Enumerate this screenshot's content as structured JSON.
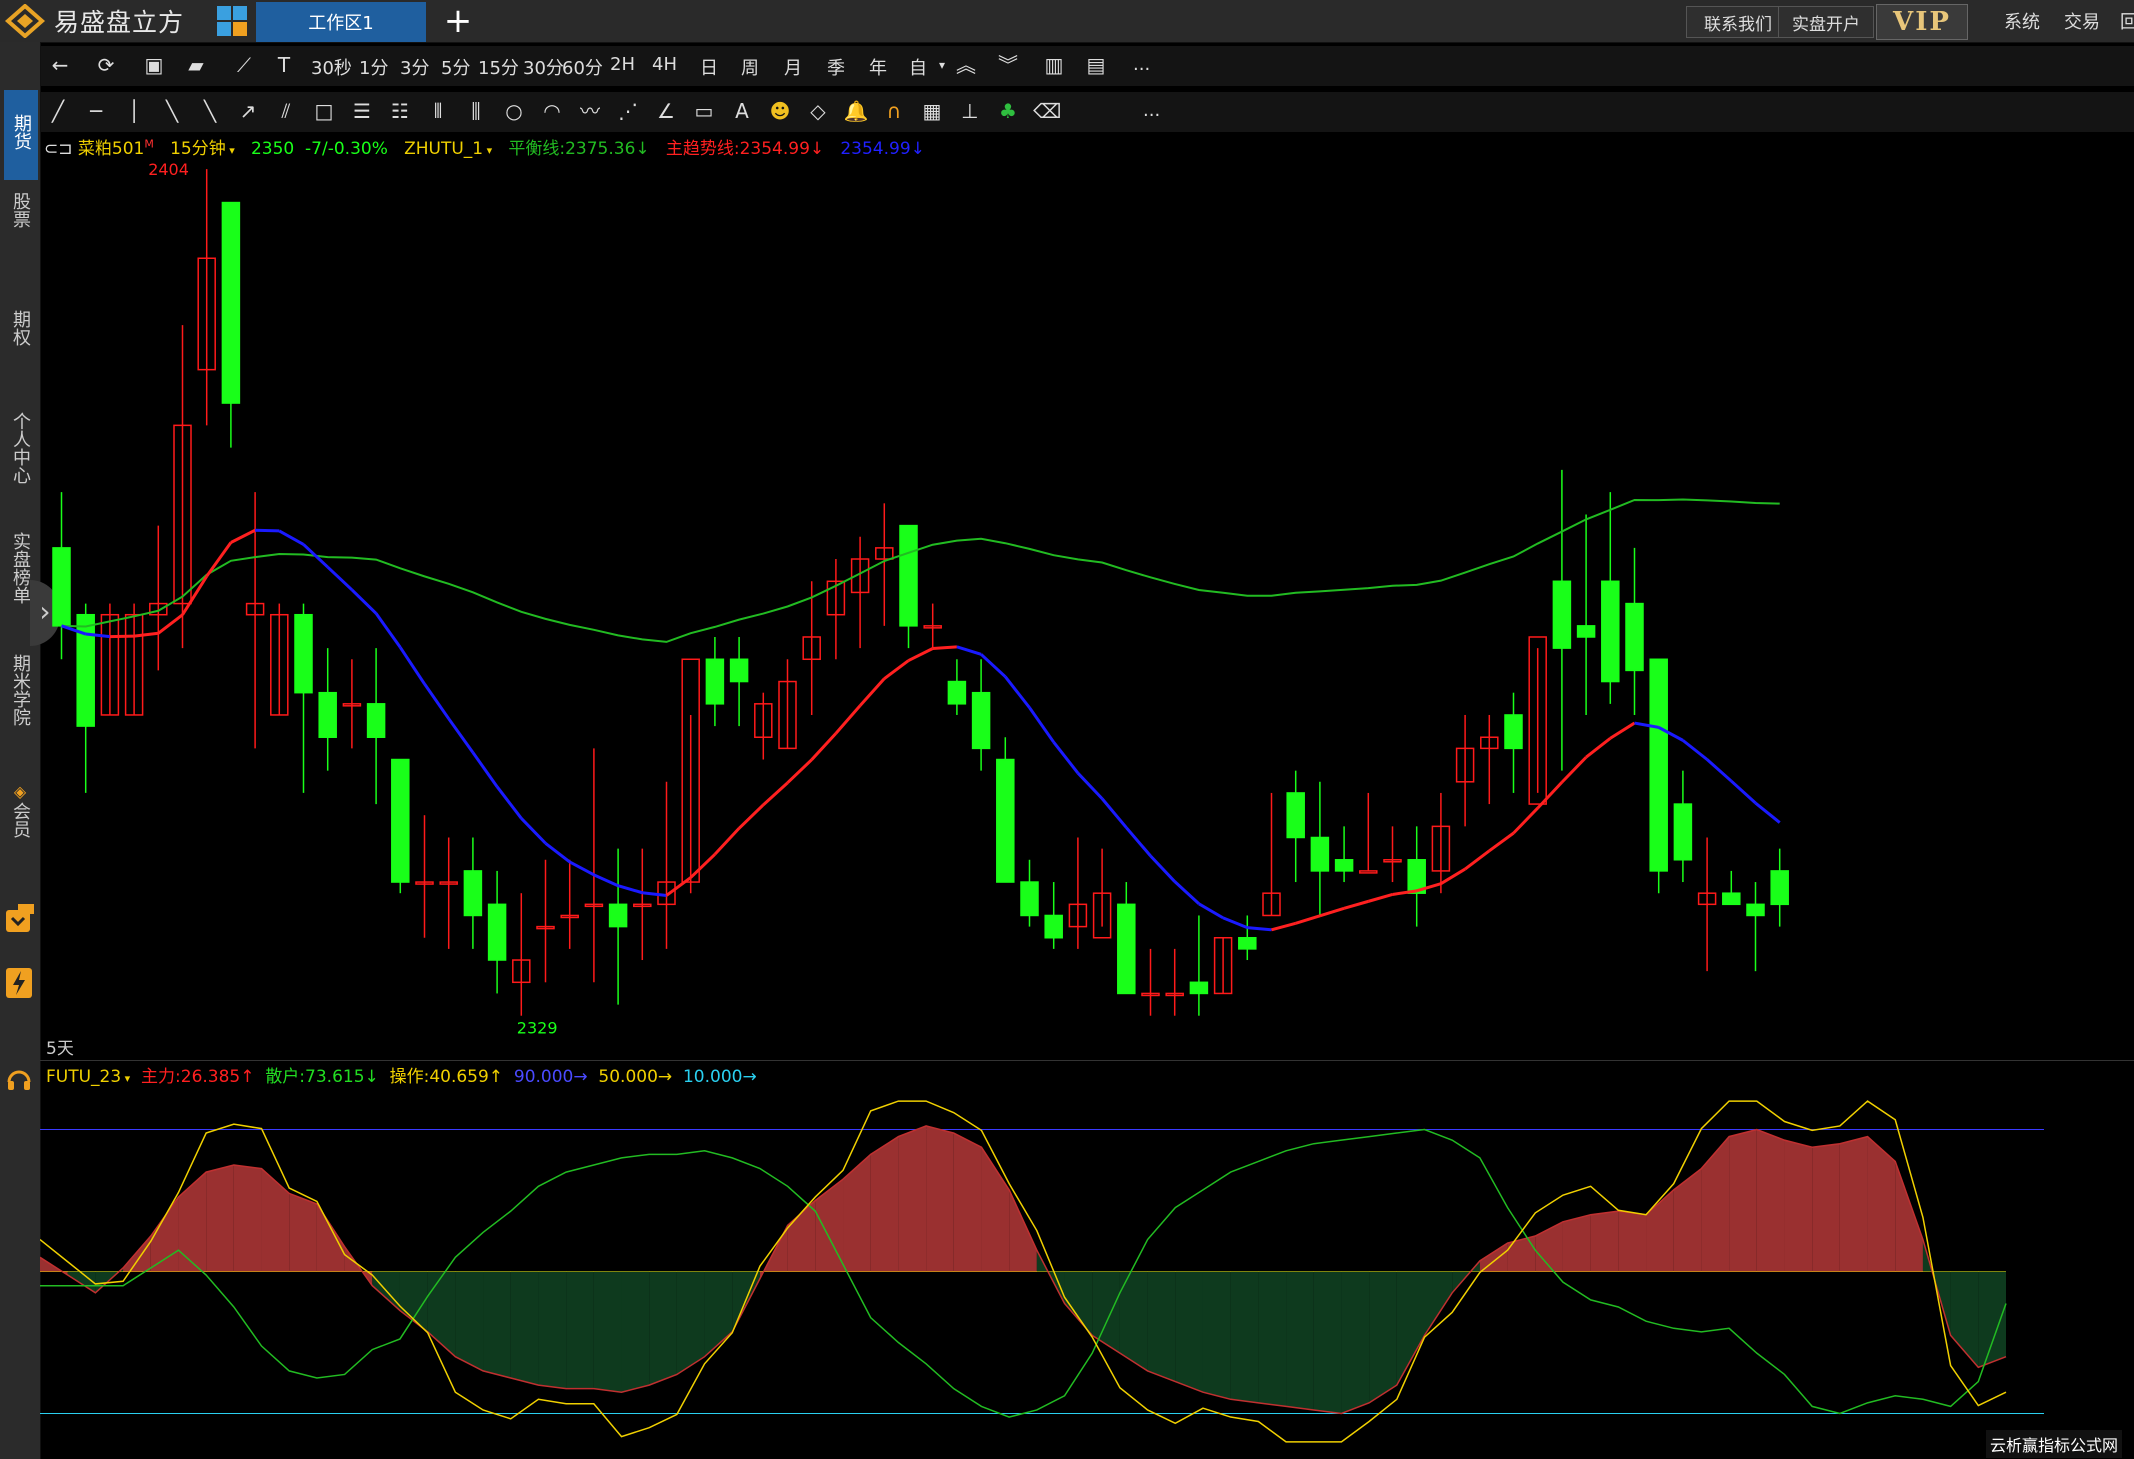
{
  "app": {
    "name": "易盛盘立方",
    "active_tab": "工作区1",
    "add_tab": "+",
    "contact": "联系我们",
    "open_account": "实盘开户",
    "vip": "VIP",
    "menu_system": "系统",
    "menu_trade": "交易",
    "menu_more": "回"
  },
  "sidebar": {
    "items": [
      {
        "label": "期货",
        "active": true
      },
      {
        "label": "股票"
      },
      {
        "label": "期权"
      },
      {
        "label": "个人中心"
      },
      {
        "label": "实盘榜单"
      },
      {
        "label": "期米学院"
      },
      {
        "label": "会员"
      }
    ],
    "toggle": "›"
  },
  "toolbar": {
    "periods": [
      "30秒",
      "1分",
      "3分",
      "5分",
      "15分",
      "30分",
      "60分",
      "2H",
      "4H",
      "日",
      "周",
      "月",
      "季",
      "年",
      "自"
    ],
    "more": "..."
  },
  "info_line": {
    "symbol": "菜粕501",
    "period": "15分钟",
    "price": "2350",
    "change": "-7/-0.30%",
    "indicator": "ZHUTU_1",
    "balance": "平衡线:2375.36↓",
    "trend": "主趋势线:2354.99↓",
    "trend2": "2354.99↓"
  },
  "indicator_line": {
    "name": "FUTU_23",
    "main": "主力:26.385↑",
    "retail": "散户:73.615↓",
    "operation": "操作:40.659↑",
    "l90": "90.000→",
    "l50": "50.000→",
    "l10": "10.000→"
  },
  "chart_labels": {
    "high": "2404",
    "low": "2329",
    "days": "5天"
  },
  "watermark": "云析赢指标公式网",
  "colors": {
    "up": "#ff1a1a",
    "down": "#19ff19",
    "trend_up": "#ff2020",
    "trend_down": "#1a1aff",
    "balance": "#22bb22"
  },
  "chart_data": [
    {
      "type": "candlestick",
      "symbol": "菜粕501",
      "period": "15分钟",
      "ylim": [
        2327,
        2406
      ],
      "candles_ohlc": [
        [
          2371,
          2376,
          2361,
          2364
        ],
        [
          2365,
          2366,
          2349,
          2355
        ],
        [
          2356,
          2366,
          2356,
          2365
        ],
        [
          2356,
          2366,
          2356,
          2365
        ],
        [
          2365,
          2373,
          2360,
          2366
        ],
        [
          2366,
          2391,
          2362,
          2382
        ],
        [
          2387,
          2405,
          2382,
          2397
        ],
        [
          2402,
          2402,
          2380,
          2384
        ],
        [
          2365,
          2376,
          2353,
          2366
        ],
        [
          2356,
          2366,
          2356,
          2365
        ],
        [
          2365,
          2366,
          2349,
          2358
        ],
        [
          2358,
          2362,
          2351,
          2354
        ],
        [
          2357,
          2361,
          2353,
          2357
        ],
        [
          2357,
          2362,
          2348,
          2354
        ],
        [
          2352,
          2350,
          2340,
          2341
        ],
        [
          2341,
          2347,
          2336,
          2341
        ],
        [
          2341,
          2345,
          2335,
          2341
        ],
        [
          2342,
          2345,
          2335,
          2338
        ],
        [
          2339,
          2342,
          2331,
          2334
        ],
        [
          2332,
          2340,
          2329,
          2334
        ],
        [
          2337,
          2343,
          2332,
          2337
        ],
        [
          2338,
          2343,
          2335,
          2338
        ],
        [
          2339,
          2353,
          2332,
          2339
        ],
        [
          2339,
          2344,
          2330,
          2337
        ],
        [
          2339,
          2344,
          2334,
          2339
        ],
        [
          2339,
          2350,
          2335,
          2341
        ],
        [
          2341,
          2356,
          2340,
          2361
        ],
        [
          2361,
          2363,
          2355,
          2357
        ],
        [
          2361,
          2363,
          2355,
          2359
        ],
        [
          2354,
          2358,
          2352,
          2357
        ],
        [
          2353,
          2361,
          2353,
          2359
        ],
        [
          2361,
          2368,
          2356,
          2363
        ],
        [
          2365,
          2370,
          2361,
          2368
        ],
        [
          2367,
          2372,
          2362,
          2370
        ],
        [
          2370,
          2375,
          2364,
          2371
        ],
        [
          2373,
          2372,
          2362,
          2364
        ],
        [
          2364,
          2366,
          2362,
          2364
        ],
        [
          2359,
          2361,
          2356,
          2357
        ],
        [
          2358,
          2361,
          2351,
          2353
        ],
        [
          2352,
          2354,
          2341,
          2341
        ],
        [
          2341,
          2343,
          2337,
          2338
        ],
        [
          2338,
          2341,
          2335,
          2336
        ],
        [
          2337,
          2345,
          2335,
          2339
        ],
        [
          2336,
          2344,
          2337,
          2340
        ],
        [
          2339,
          2341,
          2331,
          2331
        ],
        [
          2331,
          2335,
          2329,
          2331
        ],
        [
          2331,
          2335,
          2329,
          2331
        ],
        [
          2332,
          2338,
          2329,
          2331
        ],
        [
          2331,
          2336,
          2331,
          2336
        ],
        [
          2336,
          2338,
          2334,
          2335
        ],
        [
          2338,
          2349,
          2338,
          2340
        ],
        [
          2349,
          2351,
          2341,
          2345
        ],
        [
          2345,
          2350,
          2338,
          2342
        ],
        [
          2343,
          2346,
          2341,
          2342
        ],
        [
          2342,
          2349,
          2342,
          2342
        ],
        [
          2343,
          2346,
          2341,
          2343
        ],
        [
          2343,
          2346,
          2337,
          2340
        ],
        [
          2342,
          2349,
          2340,
          2346
        ],
        [
          2350,
          2356,
          2346,
          2353
        ],
        [
          2353,
          2356,
          2348,
          2354
        ],
        [
          2356,
          2358,
          2349,
          2353
        ],
        [
          2348,
          2362,
          2349,
          2363
        ],
        [
          2368,
          2378,
          2351,
          2362
        ],
        [
          2364,
          2374,
          2356,
          2363
        ],
        [
          2368,
          2376,
          2357,
          2359
        ],
        [
          2366,
          2371,
          2356,
          2360
        ],
        [
          2361,
          2357,
          2340,
          2342
        ],
        [
          2348,
          2351,
          2341,
          2343
        ],
        [
          2339,
          2345,
          2333,
          2340
        ],
        [
          2340,
          2342,
          2339,
          2339
        ],
        [
          2339,
          2341,
          2333,
          2338
        ],
        [
          2342,
          2344,
          2337,
          2339
        ]
      ],
      "series": [
        {
          "name": "平衡线",
          "last": 2375.36
        },
        {
          "name": "主趋势线",
          "last": 2354.99
        }
      ],
      "labels": {
        "high": 2404,
        "low": 2329
      }
    },
    {
      "type": "area",
      "name": "FUTU_23",
      "ylim": [
        0,
        100
      ],
      "levels": [
        90,
        50,
        10
      ],
      "series": [
        {
          "name": "主力",
          "last": 26.385,
          "values": [
            54,
            49,
            44,
            51,
            60,
            71,
            78,
            80,
            79,
            72,
            69,
            57,
            46,
            39,
            33,
            26,
            22,
            20,
            18,
            17,
            17,
            16,
            18,
            21,
            26,
            33,
            48,
            63,
            70,
            76,
            83,
            88,
            91,
            89,
            85,
            73,
            56,
            41,
            32,
            27,
            22,
            19,
            16,
            14,
            13,
            12,
            11,
            10,
            13,
            18,
            32,
            44,
            53,
            58,
            60,
            64,
            66,
            67,
            66,
            73,
            79,
            88,
            90,
            87,
            85,
            86,
            88,
            81,
            59,
            32,
            23,
            26
          ]
        },
        {
          "name": "散户",
          "last": 73.615
        },
        {
          "name": "操作",
          "last": 40.659
        }
      ]
    }
  ]
}
